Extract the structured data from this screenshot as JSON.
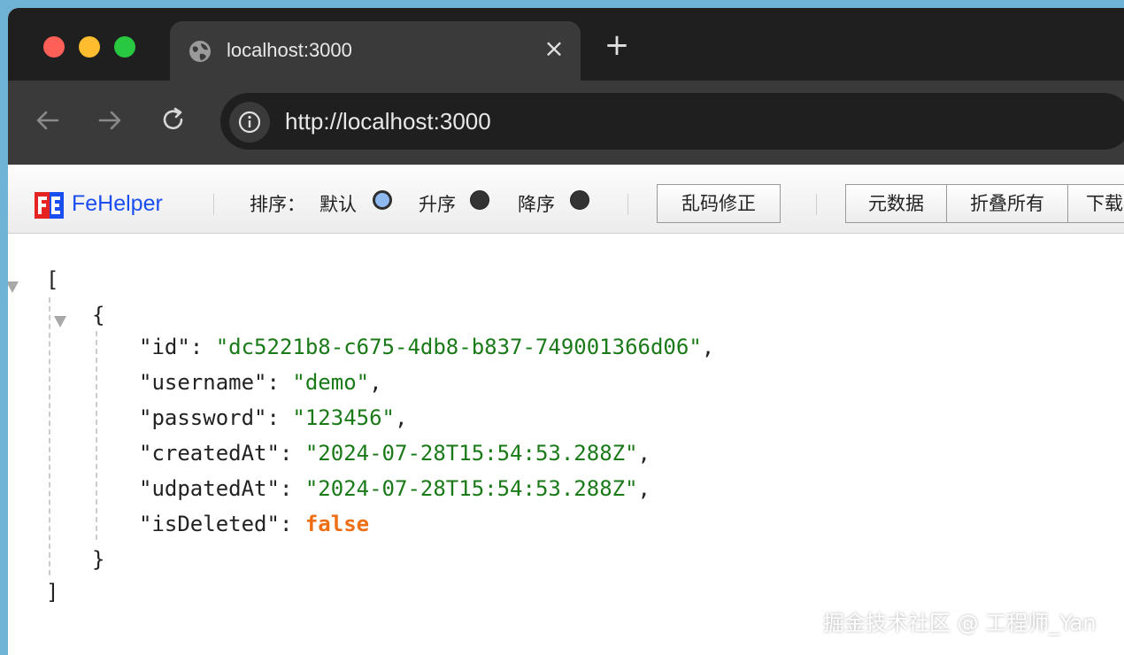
{
  "browser": {
    "tab_title": "localhost:3000",
    "url": "http://localhost:3000"
  },
  "fehelper": {
    "brand": "FeHelper",
    "sort_label": "排序：",
    "sort_options": [
      {
        "label": "默认",
        "checked": true
      },
      {
        "label": "升序",
        "checked": false
      },
      {
        "label": "降序",
        "checked": false
      }
    ],
    "fix_encoding_button": "乱码修正",
    "buttons": [
      "元数据",
      "折叠所有",
      "下载"
    ]
  },
  "json_view": {
    "open_array": "[",
    "close_array": "]",
    "open_object": "{",
    "close_object": "}",
    "fields": [
      {
        "key": "\"id\"",
        "value": "\"dc5221b8-c675-4db8-b837-749001366d06\"",
        "type": "string",
        "comma": ","
      },
      {
        "key": "\"username\"",
        "value": "\"demo\"",
        "type": "string",
        "comma": ","
      },
      {
        "key": "\"password\"",
        "value": "\"123456\"",
        "type": "string",
        "comma": ","
      },
      {
        "key": "\"createdAt\"",
        "value": "\"2024-07-28T15:54:53.288Z\"",
        "type": "string",
        "comma": ","
      },
      {
        "key": "\"udpatedAt\"",
        "value": "\"2024-07-28T15:54:53.288Z\"",
        "type": "string",
        "comma": ","
      },
      {
        "key": "\"isDeleted\"",
        "value": "false",
        "type": "boolean",
        "comma": ""
      }
    ]
  },
  "watermark": "掘金技术社区 @ 工程师_Yan",
  "colors": {
    "string": "#1a7a18",
    "boolean": "#ee6e15",
    "brand": "#1a4ef0"
  }
}
